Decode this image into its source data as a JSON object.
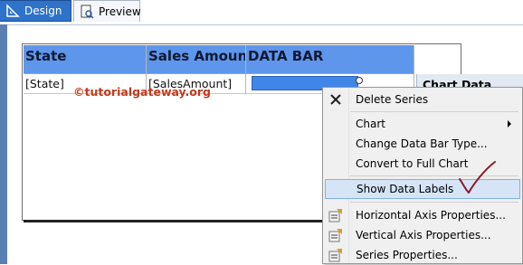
{
  "tabs": [
    {
      "label": "Design",
      "active": true,
      "icon": "design-ruler-icon"
    },
    {
      "label": "Preview",
      "active": false,
      "icon": "preview-page-icon"
    }
  ],
  "table": {
    "headers": [
      "State",
      "Sales Amount",
      "DATA BAR"
    ],
    "row": [
      "[State]",
      "[SalesAmount]",
      ""
    ],
    "header_color": "#5e96ec",
    "databar_color": "#3f86e8"
  },
  "watermark": "©tutorialgateway.org",
  "chart_data_panel": {
    "title": "Chart Data"
  },
  "context_menu": {
    "items": [
      {
        "label": "Delete Series",
        "icon": "delete-x-icon",
        "submenu": false,
        "highlighted": false
      },
      {
        "label": "Chart",
        "icon": "",
        "submenu": true,
        "highlighted": false
      },
      {
        "label": "Change Data Bar Type...",
        "icon": "",
        "submenu": false,
        "highlighted": false
      },
      {
        "label": "Convert to Full Chart",
        "icon": "",
        "submenu": false,
        "highlighted": false
      },
      {
        "label": "Show Data Labels",
        "icon": "",
        "submenu": false,
        "highlighted": true
      },
      {
        "label": "Horizontal Axis Properties...",
        "icon": "properties-icon",
        "submenu": false,
        "highlighted": false
      },
      {
        "label": "Vertical Axis Properties...",
        "icon": "properties-icon",
        "submenu": false,
        "highlighted": false
      },
      {
        "label": "Series Properties...",
        "icon": "properties-icon",
        "submenu": false,
        "highlighted": false
      }
    ]
  },
  "annotation": {
    "icon": "handdrawn-checkmark-icon",
    "color": "#8b1a2a"
  }
}
